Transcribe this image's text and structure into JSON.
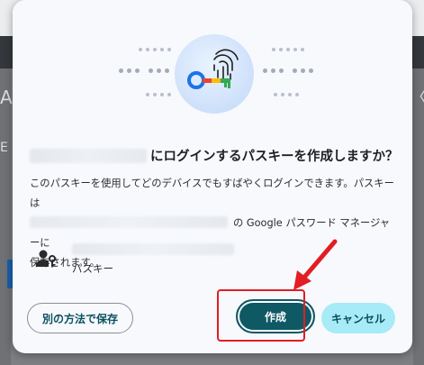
{
  "background": {
    "left_glyph": "A",
    "right_glyph": "〈",
    "left_letter": "E"
  },
  "dialog": {
    "title_suffix": "にログインするパスキーを作成しますか？",
    "body_line1": "このパスキーを使用してどのデバイスでもすばやくログインできます。パスキーは",
    "body_line2_suffix": "の Google パスワード マネージャーに",
    "body_line3": "保存されます。",
    "account_label": "パスキー",
    "buttons": {
      "alt_save": "別の方法で保存",
      "create": "作成",
      "cancel": "キャンセル"
    }
  },
  "colors": {
    "primary": "#0f5965",
    "cancel_bg": "#a7ebf6",
    "highlight": "#e21d24"
  },
  "icons": {
    "hero": "passkey-key-fingerprint-icon",
    "account": "person-key-icon",
    "annotation": "red-arrow-icon"
  }
}
